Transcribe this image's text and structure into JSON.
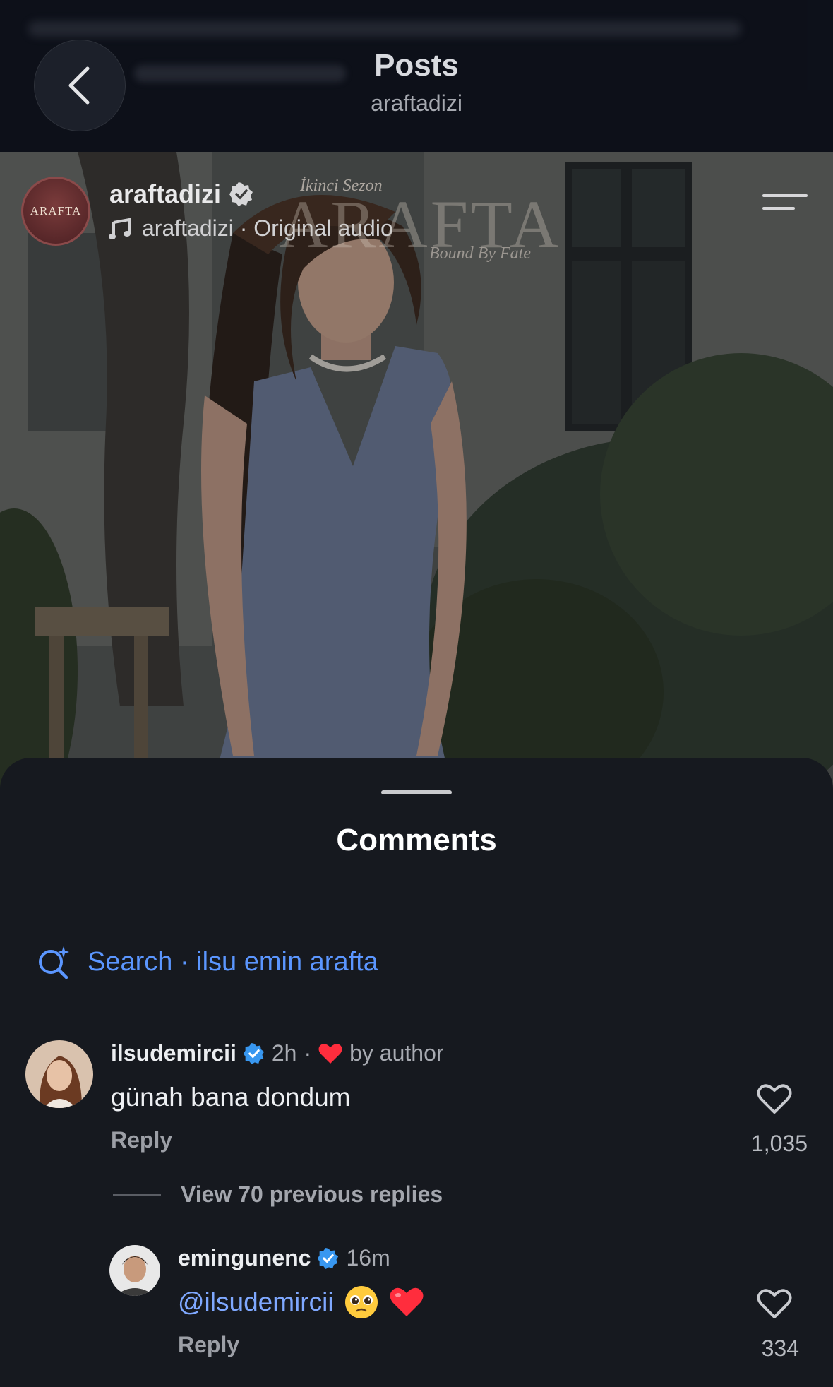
{
  "nav": {
    "title": "Posts",
    "subtitle": "araftadizi"
  },
  "post": {
    "avatar_text": "ARAFTA",
    "username": "araftadizi",
    "audio": "araftadizi · Original audio",
    "watermark": {
      "season": "İkinci Sezon",
      "title": "ARAFTA",
      "tagline": "Bound By Fate"
    }
  },
  "comments_sheet": {
    "title": "Comments",
    "search_label": "Search · ilsu emin arafta",
    "view_replies": "View 70 previous replies",
    "comments": [
      {
        "username": "ilsudemircii",
        "time": "2h",
        "badge": "by author",
        "text": "günah bana dondum",
        "reply": "Reply",
        "likes": "1,035"
      },
      {
        "username": "emingunenc",
        "time": "16m",
        "mention": "@ilsudemircii",
        "emoji": "🥺",
        "reply": "Reply",
        "likes": "334"
      }
    ]
  },
  "colors": {
    "accent_blue": "#5b96ff",
    "verified_blue": "#3897f0",
    "heart_red": "#ff2d3d",
    "sheet_bg": "#16191f"
  },
  "icons": [
    "back-chevron-icon",
    "verified-badge-icon",
    "music-note-icon",
    "menu-icon",
    "sparkle-search-icon",
    "heart-outline-icon",
    "red-heart-icon"
  ]
}
